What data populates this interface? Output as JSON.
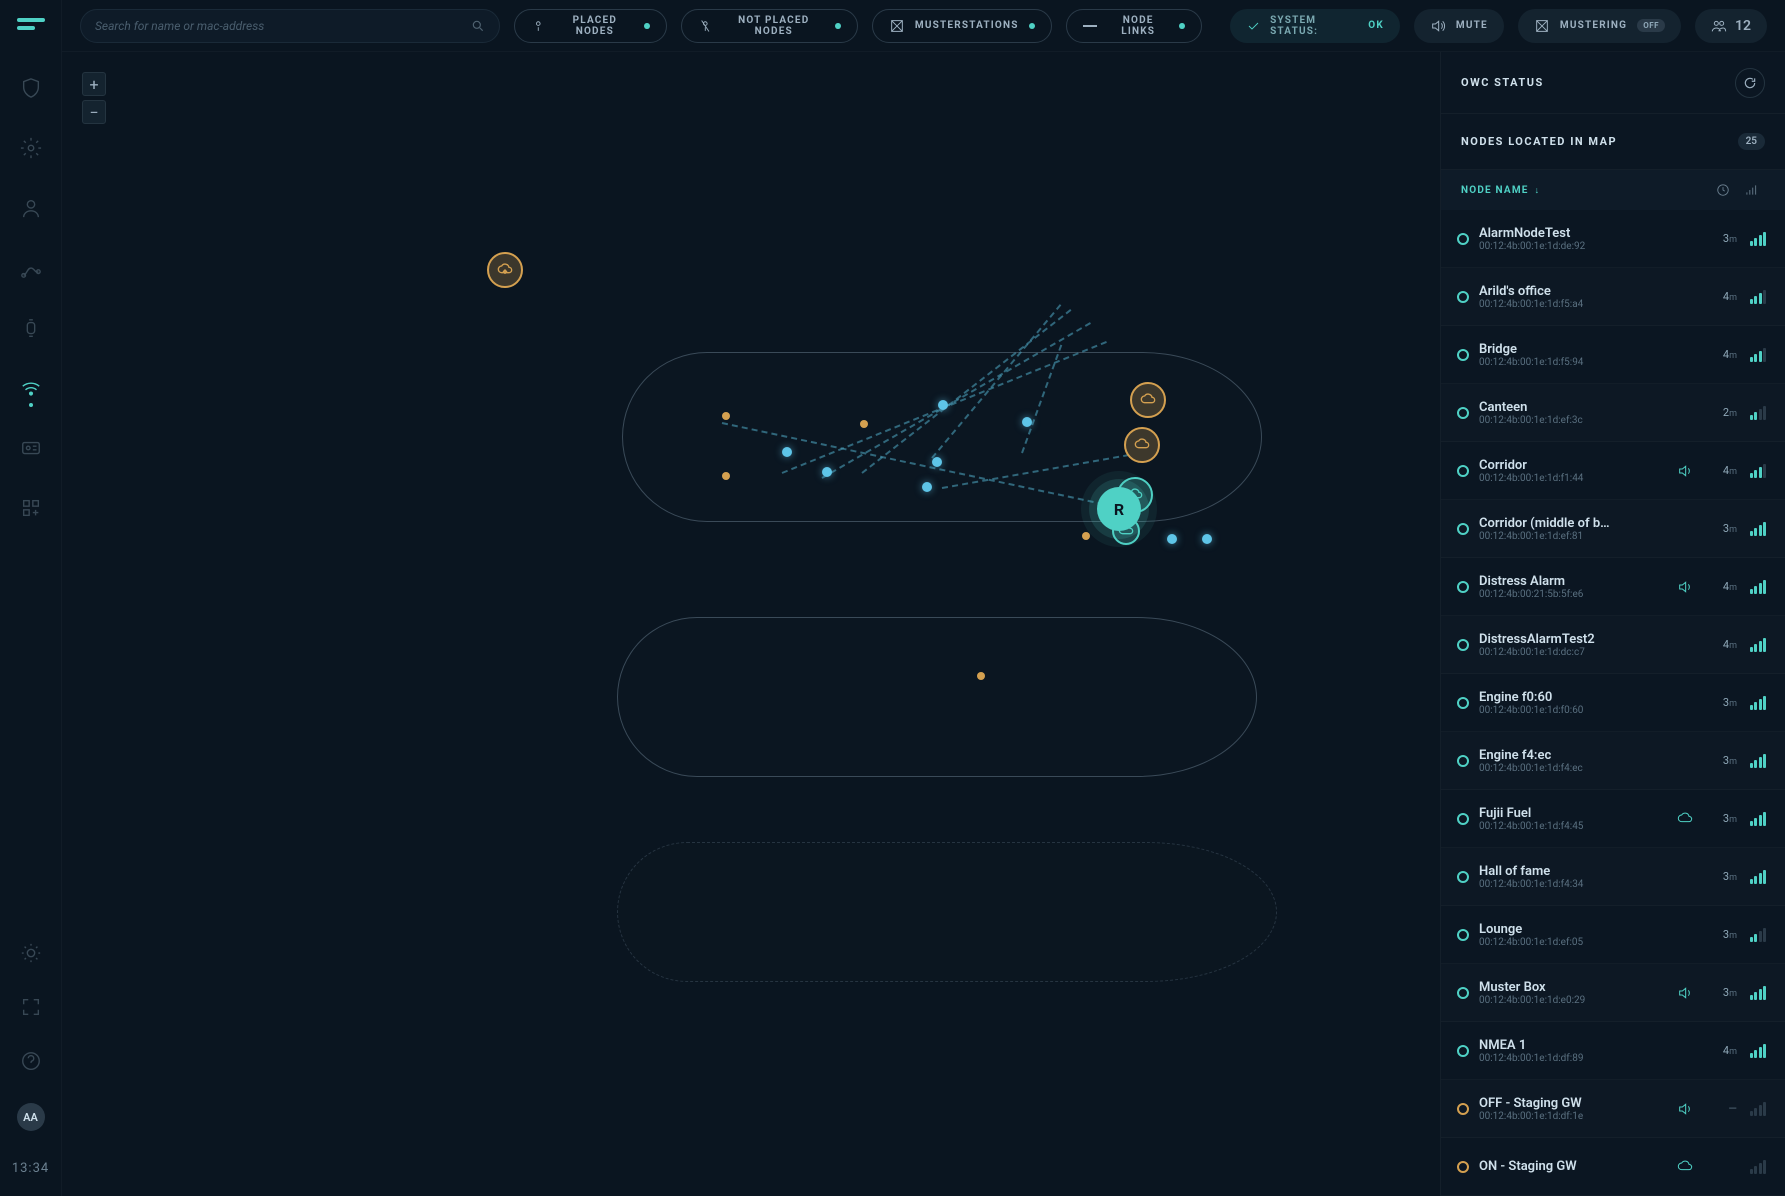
{
  "search": {
    "placeholder": "Search for name or mac-address"
  },
  "filters": {
    "placed": "PLACED NODES",
    "not_placed": "NOT PLACED NODES",
    "muster": "MUSTERSTATIONS",
    "links": "NODE LINKS"
  },
  "status_pill": {
    "label": "SYSTEM STATUS:",
    "value": "OK"
  },
  "mute": "MUTE",
  "mustering": {
    "label": "MUSTERING",
    "badge": "OFF"
  },
  "people_count": "12",
  "owc_title": "OWC STATUS",
  "nodes_panel": {
    "title": "NODES LOCATED IN MAP",
    "count": "25",
    "col_name": "NODE NAME"
  },
  "zoom": {
    "in": "+",
    "out": "−"
  },
  "avatar": "AA",
  "clock": "13:34",
  "R": "R",
  "nodes": [
    {
      "name": "AlarmNodeTest",
      "mac": "00:12:4b:00:1e:1d:de:92",
      "time": "3",
      "signal": 4,
      "sound": false,
      "status": "teal"
    },
    {
      "name": "Arild's office",
      "mac": "00:12:4b:00:1e:1d:f5:a4",
      "time": "4",
      "signal": 3,
      "sound": false,
      "status": "teal"
    },
    {
      "name": "Bridge",
      "mac": "00:12:4b:00:1e:1d:f5:94",
      "time": "4",
      "signal": 3,
      "sound": false,
      "status": "teal"
    },
    {
      "name": "Canteen",
      "mac": "00:12:4b:00:1e:1d:ef:3c",
      "time": "2",
      "signal": 2,
      "sound": false,
      "status": "teal"
    },
    {
      "name": "Corridor",
      "mac": "00:12:4b:00:1e:1d:f1:44",
      "time": "4",
      "signal": 3,
      "sound": true,
      "status": "teal"
    },
    {
      "name": "Corridor (middle of b…",
      "mac": "00:12:4b:00:1e:1d:ef:81",
      "time": "3",
      "signal": 4,
      "sound": false,
      "status": "teal"
    },
    {
      "name": "Distress Alarm",
      "mac": "00:12:4b:00:21:5b:5f:e6",
      "time": "4",
      "signal": 4,
      "sound": true,
      "status": "teal"
    },
    {
      "name": "DistressAlarmTest2",
      "mac": "00:12:4b:00:1e:1d:dc:c7",
      "time": "4",
      "signal": 4,
      "sound": false,
      "status": "teal"
    },
    {
      "name": "Engine f0:60",
      "mac": "00:12:4b:00:1e:1d:f0:60",
      "time": "3",
      "signal": 4,
      "sound": false,
      "status": "teal"
    },
    {
      "name": "Engine f4:ec",
      "mac": "00:12:4b:00:1e:1d:f4:ec",
      "time": "3",
      "signal": 4,
      "sound": false,
      "status": "teal"
    },
    {
      "name": "Fujii Fuel",
      "mac": "00:12:4b:00:1e:1d:f4:45",
      "time": "3",
      "signal": 4,
      "sound": false,
      "status": "teal",
      "cloud": true
    },
    {
      "name": "Hall of fame",
      "mac": "00:12:4b:00:1e:1d:f4:34",
      "time": "3",
      "signal": 4,
      "sound": false,
      "status": "teal"
    },
    {
      "name": "Lounge",
      "mac": "00:12:4b:00:1e:1d:ef:05",
      "time": "3",
      "signal": 2,
      "sound": false,
      "status": "teal"
    },
    {
      "name": "Muster Box",
      "mac": "00:12:4b:00:1e:1d:e0:29",
      "time": "3",
      "signal": 4,
      "sound": true,
      "status": "teal"
    },
    {
      "name": "NMEA 1",
      "mac": "00:12:4b:00:1e:1d:df:89",
      "time": "4",
      "signal": 4,
      "sound": false,
      "status": "teal"
    },
    {
      "name": "OFF - Staging GW",
      "mac": "00:12:4b:00:1e:1d:df:1e",
      "time": "—",
      "signal": 0,
      "sound": true,
      "status": "orange"
    },
    {
      "name": "ON - Staging GW",
      "mac": "",
      "time": "",
      "signal": 0,
      "sound": false,
      "status": "orange",
      "cloud": true
    }
  ]
}
